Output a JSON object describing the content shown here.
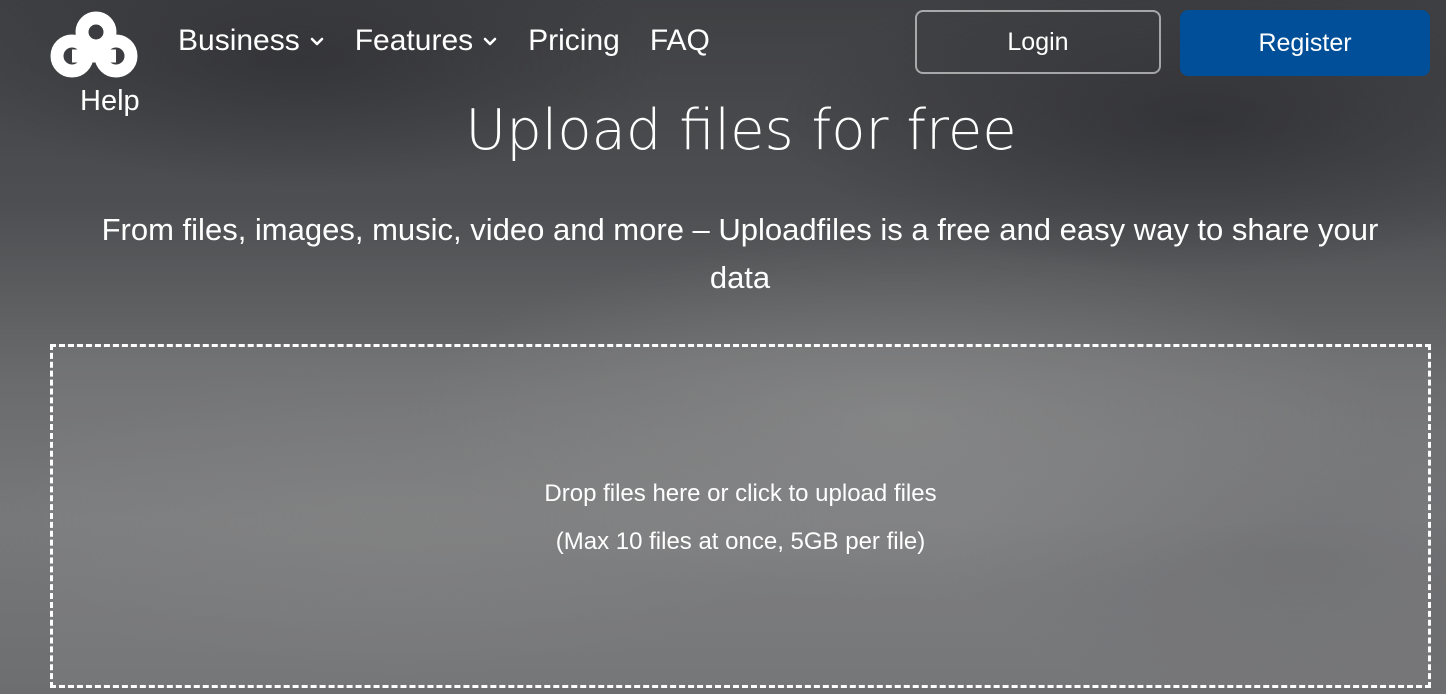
{
  "brand": {
    "logo_icon": "infinity-cloud-logo-icon",
    "help_label": "Help"
  },
  "nav": {
    "items": [
      {
        "label": "Business",
        "icon": "chevron-down-icon"
      },
      {
        "label": "Features",
        "icon": "chevron-down-icon"
      },
      {
        "label": "Pricing"
      },
      {
        "label": "FAQ"
      }
    ]
  },
  "auth": {
    "login_label": "Login",
    "register_label": "Register",
    "register_color": "#004f98"
  },
  "hero": {
    "title": "Upload files for free",
    "subtitle": "From files, images, music, video and more – Uploadfiles is a free and easy way to share your data"
  },
  "dropzone": {
    "main_text": "Drop files here or click to upload files",
    "limits_text": "(Max 10 files at once, 5GB per file)"
  }
}
